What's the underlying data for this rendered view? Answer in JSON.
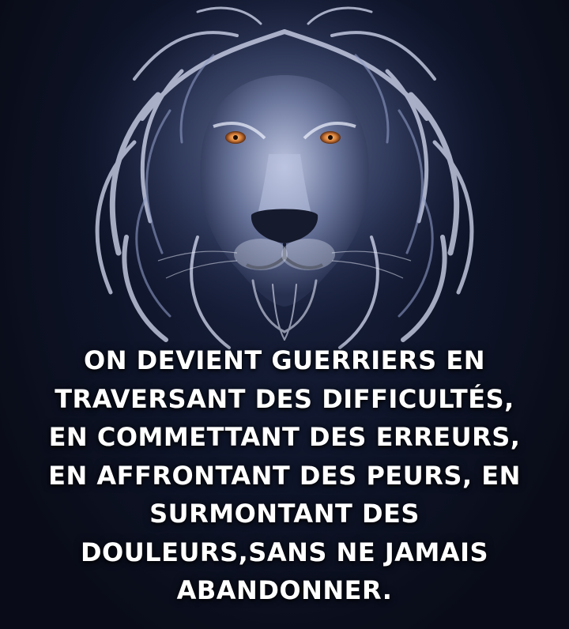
{
  "quote": {
    "lines": [
      "ON DEVIENT GUERRIERS EN",
      "TRAVERSANT DES DIFFICULTÉS,",
      "EN COMMETTANT DES ERREURS,",
      "EN AFFRONTANT DES PEURS, EN",
      "SURMONTANT DES",
      "DOULEURS,SANS NE JAMAIS",
      "ABANDONNER."
    ]
  },
  "colors": {
    "background": "#0b0f1e",
    "text": "#ffffff",
    "mane": "#c9d3ee",
    "eyes": "#d9803a"
  },
  "image": {
    "subject": "lion-head-illustration"
  }
}
